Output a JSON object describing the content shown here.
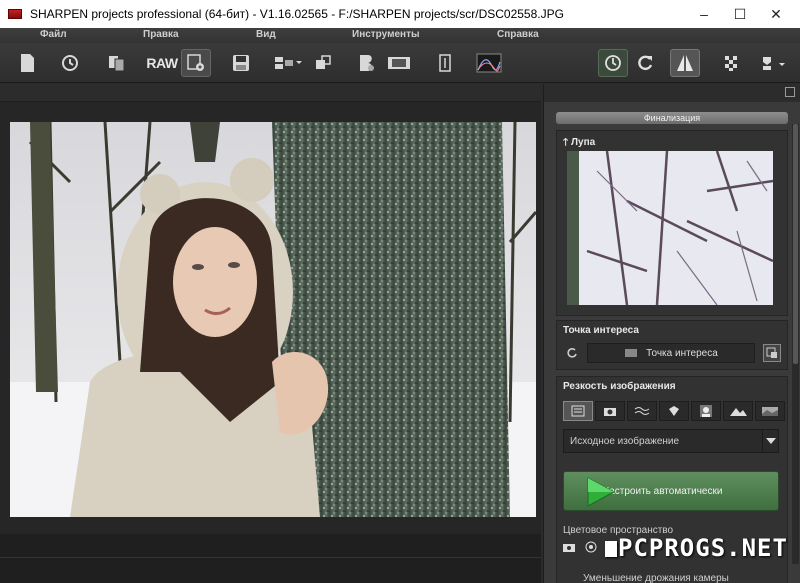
{
  "window": {
    "title": "SHARPEN projects professional (64-бит) - V1.16.02565 - F:/SHARPEN projects/scr/DSC02558.JPG",
    "min": "–",
    "max": "☐",
    "close": "✕"
  },
  "menu": {
    "file": "Файл",
    "edit": "Правка",
    "view": "Вид",
    "tools": "Инструменты",
    "help": "Справка"
  },
  "toolbar": {
    "raw_label": "RAW"
  },
  "panel": {
    "finalization_tab": "Финализация",
    "loupe_title": "Лупа",
    "poi_title": "Точка интереса",
    "poi_button": "Точка интереса",
    "sharp_title": "Резкость изображения",
    "dropdown_value": "Исходное изображение",
    "auto_button": "Настроить автоматически",
    "color_space_label": "Цветовое пространство",
    "shake_label": "Уменьшение дрожания камеры"
  },
  "watermark": "PCPROGS.NET",
  "colors": {
    "accent_green": "#4f7f4f",
    "background": "#2b2b2b"
  }
}
